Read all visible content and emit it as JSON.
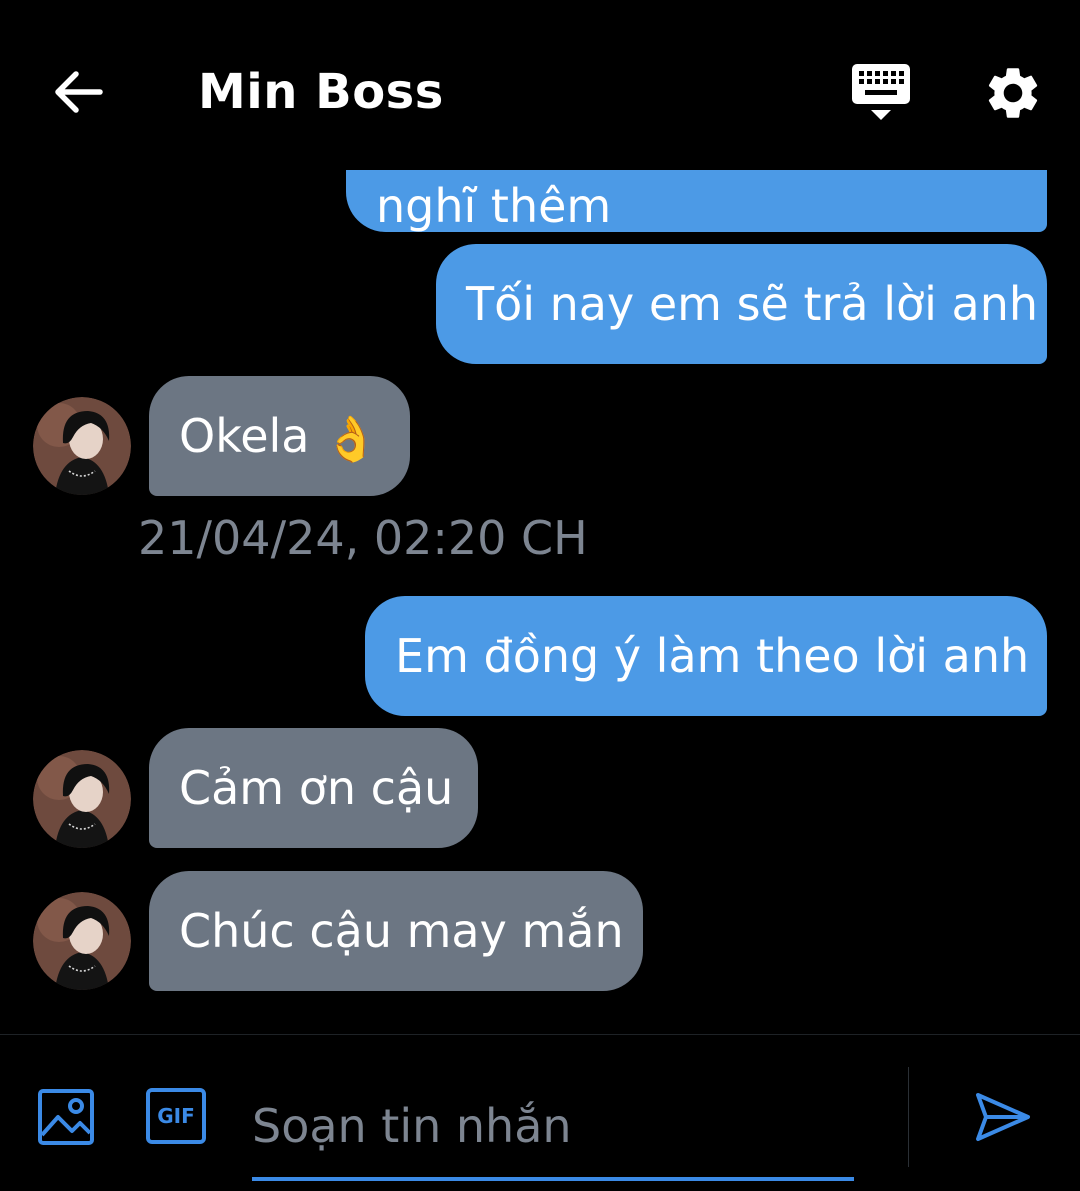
{
  "header": {
    "title": "Min Boss",
    "back_icon": "arrow-left-icon",
    "keyboard_icon": "keyboard-icon",
    "settings_icon": "gear-icon"
  },
  "messages": {
    "partial_top": "nghĩ thêm",
    "out_1": "Tối nay em sẽ trả lời anh",
    "in_1": "Okela",
    "in_1_emoji": "👌",
    "timestamp": "21/04/24, 02:20 CH",
    "out_2": "Em đồng ý làm theo lời anh",
    "in_2": "Cảm ơn cậu",
    "in_3": "Chúc cậu may mắn"
  },
  "compose": {
    "placeholder": "Soạn tin nhắn",
    "image_icon": "image-icon",
    "gif_label": "GIF",
    "send_icon": "send-icon"
  },
  "colors": {
    "background": "#000000",
    "outgoing_bubble": "#4c9ae6",
    "incoming_bubble": "#6c7683",
    "timestamp_text": "#7d8591",
    "accent": "#3b8ae6"
  }
}
